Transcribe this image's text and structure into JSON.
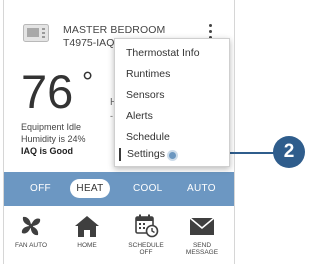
{
  "header": {
    "room_name": "MASTER BEDROOM",
    "model": "T4975-IAQ"
  },
  "current": {
    "temperature": "76",
    "degree_symbol": "°",
    "equipment_status": "Equipment Idle",
    "humidity": "Humidity is 24%",
    "iaq": "IAQ is Good"
  },
  "obscured_text": {
    "line1": "H",
    "line2": "-"
  },
  "menu": {
    "items": [
      {
        "label": "Thermostat Info"
      },
      {
        "label": "Runtimes"
      },
      {
        "label": "Sensors"
      },
      {
        "label": "Alerts"
      },
      {
        "label": "Schedule"
      },
      {
        "label": "Settings"
      }
    ],
    "selected": "Settings"
  },
  "modes": {
    "off": "OFF",
    "heat": "HEAT",
    "cool": "COOL",
    "auto": "AUTO",
    "selected": "HEAT"
  },
  "actions": {
    "fan": "FAN AUTO",
    "home": "HOME",
    "schedule_line1": "SCHEDULE",
    "schedule_line2": "OFF",
    "message_line1": "SEND",
    "message_line2": "MESSAGE"
  },
  "callout": {
    "number": "2"
  },
  "colors": {
    "mode_bar": "#6c97c2",
    "callout": "#2f5d8c",
    "icon": "#3f3f3f"
  },
  "icons": [
    "thermostat-device-icon",
    "kebab-menu-icon",
    "fan-icon",
    "home-icon",
    "calendar-clock-icon",
    "envelope-icon"
  ]
}
